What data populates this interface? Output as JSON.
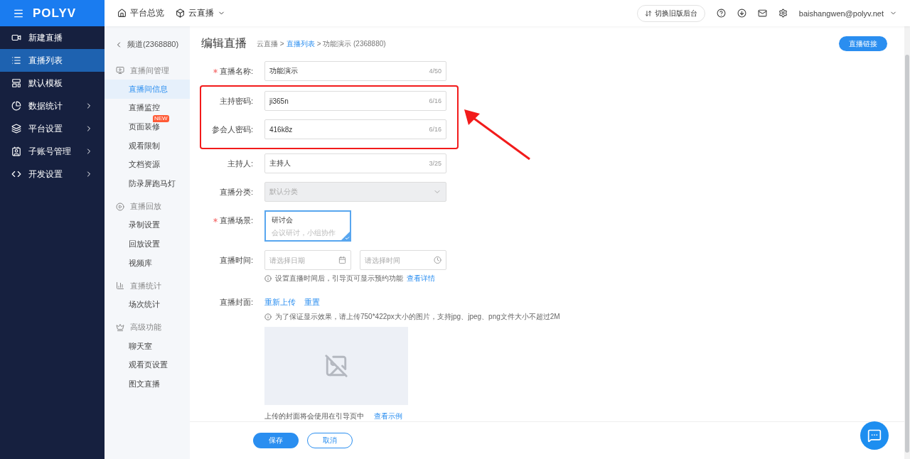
{
  "topbar": {
    "logo": "POLYV",
    "nav": [
      {
        "label": "平台总览",
        "kind": "home"
      },
      {
        "label": "云直播",
        "kind": "dropdown"
      }
    ],
    "switch_button": "切换旧版后台",
    "user": "baishangwen@polyv.net"
  },
  "sidebar": {
    "items": [
      {
        "label": "新建直播",
        "selected": false,
        "expandable": false
      },
      {
        "label": "直播列表",
        "selected": true,
        "expandable": false
      },
      {
        "label": "默认模板",
        "selected": false,
        "expandable": false
      },
      {
        "label": "数据统计",
        "selected": false,
        "expandable": true
      },
      {
        "label": "平台设置",
        "selected": false,
        "expandable": true
      },
      {
        "label": "子账号管理",
        "selected": false,
        "expandable": true
      },
      {
        "label": "开发设置",
        "selected": false,
        "expandable": true
      }
    ]
  },
  "subnav": {
    "back": "频道(2368880)",
    "groups": [
      {
        "title": "直播间管理",
        "items": [
          {
            "label": "直播间信息",
            "selected": true
          },
          {
            "label": "直播监控",
            "selected": false
          },
          {
            "label": "页面装修",
            "selected": false,
            "badge": "NEW"
          },
          {
            "label": "观看限制",
            "selected": false
          },
          {
            "label": "文档资源",
            "selected": false
          },
          {
            "label": "防录屏跑马灯",
            "selected": false
          }
        ]
      },
      {
        "title": "直播回放",
        "items": [
          {
            "label": "录制设置",
            "selected": false
          },
          {
            "label": "回放设置",
            "selected": false
          },
          {
            "label": "视频库",
            "selected": false
          }
        ]
      },
      {
        "title": "直播统计",
        "items": [
          {
            "label": "场次统计",
            "selected": false
          }
        ]
      },
      {
        "title": "高级功能",
        "items": [
          {
            "label": "聊天室",
            "selected": false
          },
          {
            "label": "观看页设置",
            "selected": false
          },
          {
            "label": "图文直播",
            "selected": false
          }
        ]
      }
    ]
  },
  "page": {
    "title": "编辑直播",
    "breadcrumb": [
      {
        "label": "云直播 >",
        "link": false
      },
      {
        "label": "直播列表",
        "link": true
      },
      {
        "label": "> 功能演示 (2368880)",
        "link": false
      }
    ],
    "link_button": "直播链接"
  },
  "form": {
    "fields": [
      {
        "kind": "text",
        "label": "直播名称:",
        "required": true,
        "highlighted": false,
        "value": "功能演示",
        "count": "4/50"
      },
      {
        "kind": "text",
        "label": "主持密码:",
        "required": false,
        "highlighted": true,
        "value": "ji365n",
        "count": "6/16"
      },
      {
        "kind": "text",
        "label": "参会人密码:",
        "required": false,
        "highlighted": true,
        "value": "416k8z",
        "count": "6/16"
      },
      {
        "kind": "text",
        "label": "主持人:",
        "required": false,
        "highlighted": false,
        "value": "主持人",
        "count": "3/25"
      },
      {
        "kind": "select",
        "label": "直播分类:",
        "required": false,
        "highlighted": false,
        "value": "默认分类",
        "disabled": true
      },
      {
        "kind": "scene",
        "label": "直播场景:",
        "required": true,
        "highlighted": false,
        "title": "研讨会",
        "subtitle": "会议研讨，小组协作",
        "selected": true
      },
      {
        "kind": "datetime",
        "label": "直播时间:",
        "required": false,
        "highlighted": false,
        "date_placeholder": "请选择日期",
        "time_placeholder": "请选择时间",
        "hint": "设置直播时间后，引导页可显示预约功能",
        "hint_link": "查看详情"
      },
      {
        "kind": "cover",
        "label": "直播封面:",
        "required": false,
        "highlighted": false,
        "actions": [
          "重新上传",
          "重置"
        ],
        "hint": "为了保证显示效果，请上传750*422px大小的图片，支持jpg、jpeg、png文件大小不超过2M",
        "note": "上传的封面将会使用在引导页中",
        "note_link": "查看示例"
      }
    ]
  },
  "footer": {
    "buttons": [
      {
        "label": "保存",
        "kind": "primary"
      },
      {
        "label": "取消",
        "kind": "secondary"
      }
    ]
  }
}
